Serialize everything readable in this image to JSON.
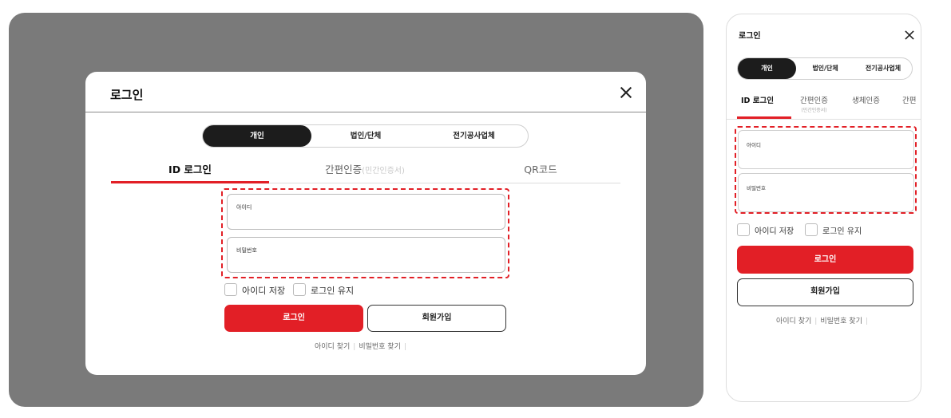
{
  "desktop": {
    "title": "로그인",
    "member_types": [
      "개인",
      "법인/단체",
      "전기공사업체"
    ],
    "tabs": [
      {
        "label": "ID 로그인",
        "sub": ""
      },
      {
        "label": "간편인증",
        "sub": "(민간인증서)"
      },
      {
        "label": "QR코드",
        "sub": ""
      }
    ],
    "id_field_label": "아이디",
    "password_field_label": "비밀번호",
    "remember_id_label": "아이디 저장",
    "keep_login_label": "로그인 유지",
    "login_button": "로그인",
    "signup_button": "회원가입",
    "find_id": "아이디 찾기",
    "find_password": "비밀번호 찾기",
    "separator": "|"
  },
  "mobile": {
    "title": "로그인",
    "member_types": [
      "개인",
      "법인/단체",
      "전기공사업체"
    ],
    "tabs": [
      {
        "label": "ID 로그인",
        "sub": ""
      },
      {
        "label": "간편인증",
        "sub": "(민간인증서)"
      },
      {
        "label": "생체인증",
        "sub": ""
      },
      {
        "label": "간편",
        "sub": ""
      }
    ],
    "id_field_label": "아이디",
    "password_field_label": "비밀번호",
    "remember_id_label": "아이디 저장",
    "keep_login_label": "로그인 유지",
    "login_button": "로그인",
    "signup_button": "회원가입",
    "find_id": "아이디 찾기",
    "find_password": "비밀번호 찾기",
    "separator": "|"
  },
  "colors": {
    "accent": "#e21f26",
    "segment_active": "#1c1c1c",
    "overlay": "#7a7a7a"
  },
  "icons": {
    "close": "close-icon"
  }
}
